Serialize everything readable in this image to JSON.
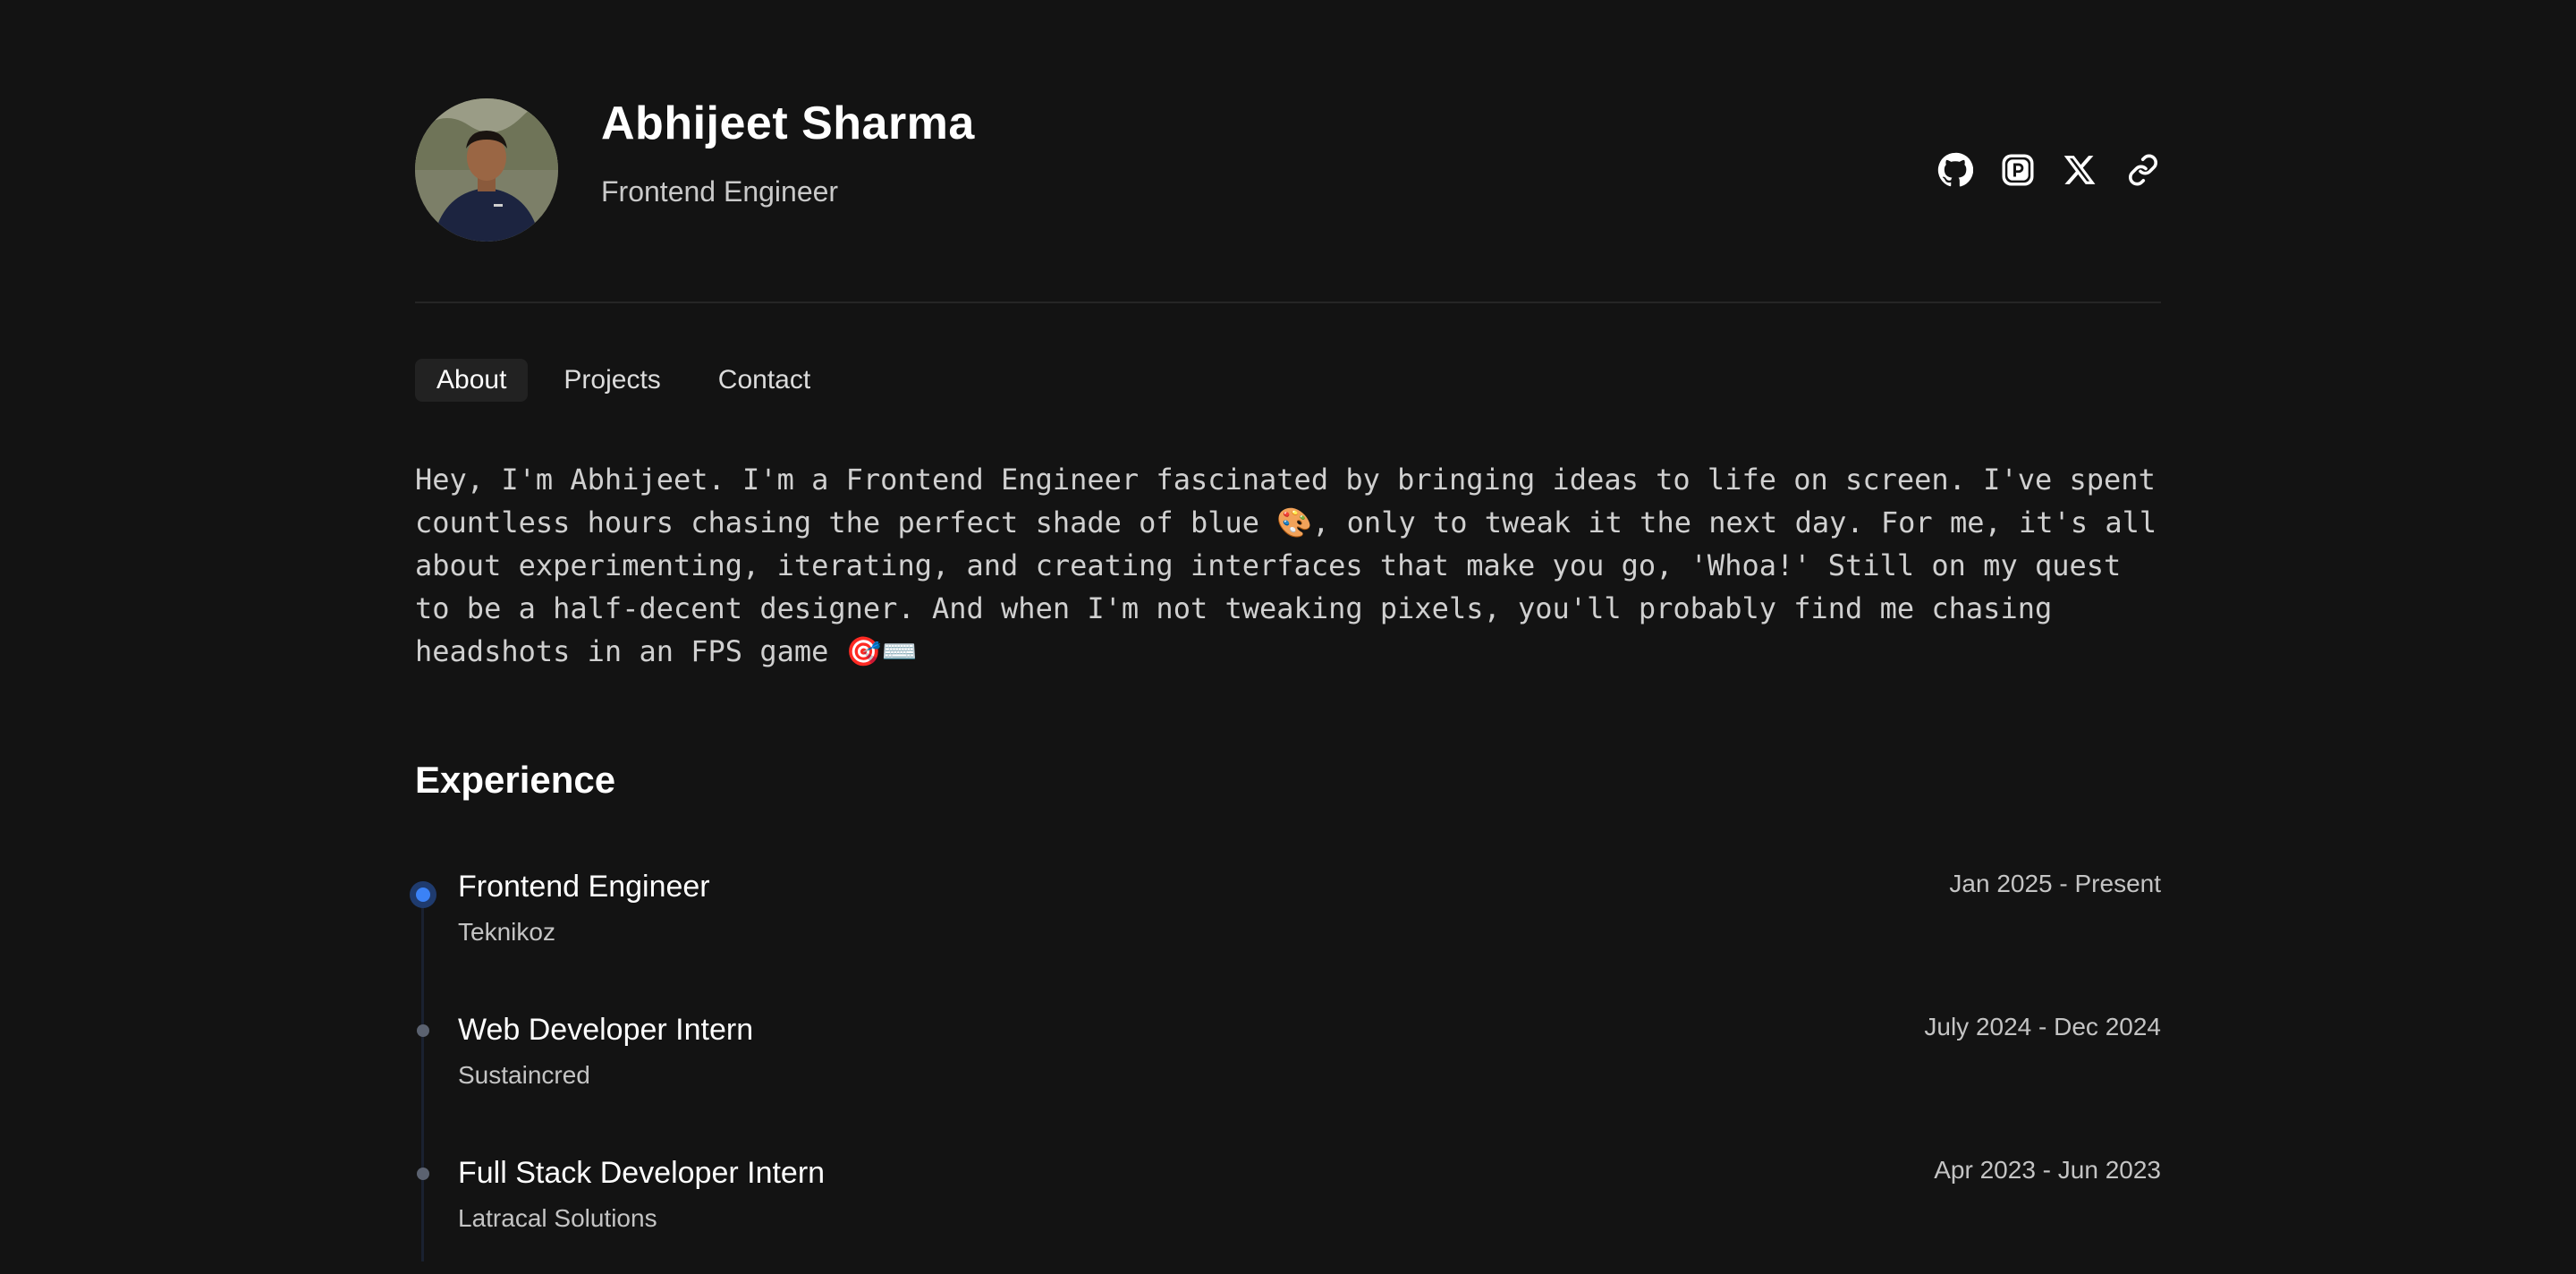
{
  "profile": {
    "name": "Abhijeet Sharma",
    "role": "Frontend Engineer"
  },
  "socials": [
    {
      "icon": "github-icon"
    },
    {
      "icon": "peerlist-icon"
    },
    {
      "icon": "x-icon"
    },
    {
      "icon": "link-icon"
    }
  ],
  "tabs": [
    {
      "label": "About",
      "active": true
    },
    {
      "label": "Projects",
      "active": false
    },
    {
      "label": "Contact",
      "active": false
    }
  ],
  "about": {
    "text": "Hey, I'm Abhijeet. I'm a Frontend Engineer fascinated by bringing ideas to life on screen. I've spent countless hours chasing the perfect shade of blue 🎨, only to tweak it the next day. For me, it's all about experimenting, iterating, and creating interfaces that make you go, 'Whoa!' Still on my quest to be a half-decent designer. And when I'm not tweaking pixels, you'll probably find me chasing headshots in an FPS game 🎯⌨️"
  },
  "experience": {
    "title": "Experience",
    "items": [
      {
        "title": "Frontend Engineer",
        "company": "Teknikoz",
        "dates": "Jan 2025 - Present",
        "current": true
      },
      {
        "title": "Web Developer Intern",
        "company": "Sustaincred",
        "dates": "July 2024 - Dec 2024",
        "current": false
      },
      {
        "title": "Full Stack Developer Intern",
        "company": "Latracal Solutions",
        "dates": "Apr 2023 - Jun 2023",
        "current": false
      }
    ]
  },
  "colors": {
    "background": "#131313",
    "accent": "#3b82f6"
  }
}
